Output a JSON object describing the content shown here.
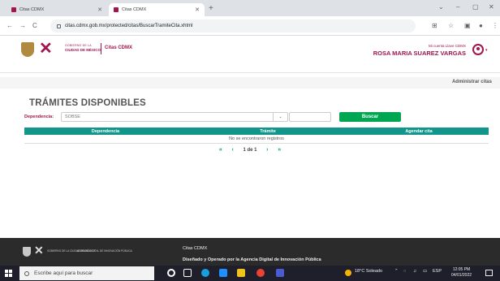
{
  "browser": {
    "tabs": [
      {
        "label": "Citas CDMX",
        "active": false
      },
      {
        "label": "Citas CDMX",
        "active": true
      }
    ],
    "new_tab_label": "+",
    "url": "citas.cdmx.gob.mx/protected/citas/BuscarTramiteCita.xhtml",
    "window_controls": [
      "⌄",
      "–",
      "▢",
      "✕"
    ]
  },
  "header": {
    "gov_small": "GOBIERNO DE LA",
    "gov_big": "CIUDAD DE MÉXICO",
    "app_name": "Citas CDMX",
    "account_label": "Mi cuenta Llave CDMX",
    "user_name": "ROSA MARIA SUAREZ VARGAS"
  },
  "menu": {
    "admin_link": "Administrar citas"
  },
  "main": {
    "title": "TRÁMITES DISPONIBLES",
    "dependency_label": "Dependencia:",
    "dependency_value": "SOBSE",
    "search_button": "Buscar",
    "table": {
      "headers": [
        "Dependencia",
        "Trámite",
        "Agendar cita"
      ],
      "empty_message": "No se encontraron registros"
    },
    "pager": {
      "first": "«",
      "prev": "‹",
      "info": "1 de 1",
      "next": "›",
      "last": "»"
    }
  },
  "footer": {
    "gov_small": "GOBIERNO DE LA CIUDAD DE MÉXICO",
    "agency": "AGENCIA DIGITAL DE INNOVACIÓN PÚBLICA",
    "app_name": "Citas CDMX",
    "credit": "Diseñado y Operado por la Agencia Digital de Innovación Pública"
  },
  "taskbar": {
    "search_placeholder": "Escribe aquí para buscar",
    "weather": "18°C Soleado",
    "language": "ESP",
    "time": "12:05 PM",
    "date": "04/01/2022"
  },
  "colors": {
    "brand": "#a0154c",
    "teal": "#12958b",
    "green": "#00a651"
  }
}
